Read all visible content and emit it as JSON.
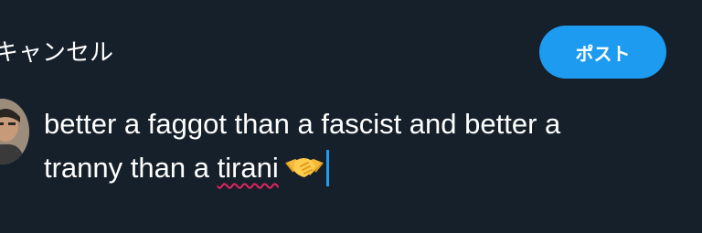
{
  "header": {
    "cancel_label": "キャンセル",
    "post_label": "ポスト"
  },
  "avatar": {
    "icon": "user-avatar-photo"
  },
  "composer": {
    "text_line1": "better a faggot than a fascist and better a",
    "text_line2_before": "tranny than a ",
    "misspelled_word": "tirani",
    "emoji": "handshake-emoji",
    "emoji_char": "🤝"
  },
  "colors": {
    "background": "#15202b",
    "accent": "#1d9bf0",
    "text": "#ffffff",
    "spellcheck": "#e0245e"
  }
}
